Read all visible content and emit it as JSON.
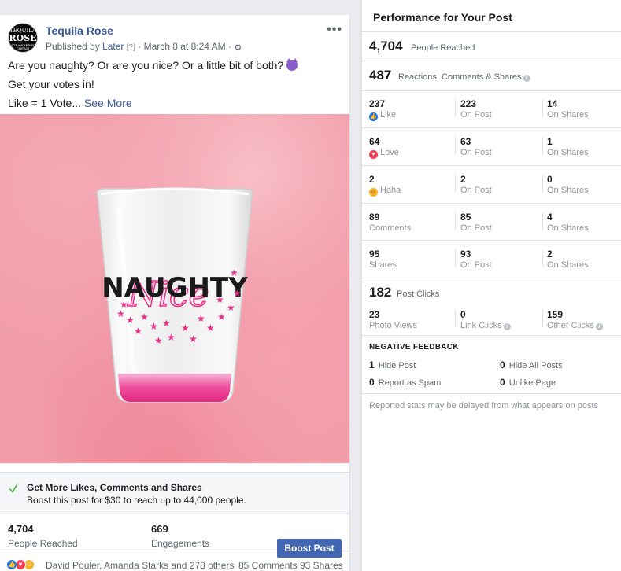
{
  "post": {
    "page_name": "Tequila Rose",
    "avatar_text": [
      "TEQUILA",
      "ROSE",
      "STRAWBERRY CREAM"
    ],
    "published_by_prefix": "Published by",
    "published_by": "Later",
    "help_mark": "[?]",
    "date": "March 8 at 8:24 AM",
    "more_label": "•••",
    "text_line1": "Are you naughty? Or are you nice? Or a little bit of both?",
    "text_line2": "Get your votes in!",
    "text_line3": "Like = 1 Vote...",
    "see_more": "See More",
    "image_text_main": "NAUGHTY",
    "image_text_script": "Nice",
    "boost_title": "Get More Likes, Comments and Shares",
    "boost_sub": "Boost this post for $30 to reach up to 44,000 people.",
    "people_reached_value": "4,704",
    "people_reached_label": "People Reached",
    "engagements_value": "669",
    "engagements_label": "Engagements",
    "boost_button": "Boost Post",
    "reaction_names": "David Pouler, Amanda Starks and 278 others",
    "comments_count": "85 Comments",
    "shares_count": "93 Shares"
  },
  "panel": {
    "title": "Performance for Your Post",
    "reached_value": "4,704",
    "reached_label": "People Reached",
    "rcs_value": "487",
    "rcs_label": "Reactions, Comments & Shares",
    "rows": [
      {
        "a": "237",
        "a_lbl": "Like",
        "b": "223",
        "b_lbl": "On Post",
        "c": "14",
        "c_lbl": "On Shares"
      },
      {
        "a": "64",
        "a_lbl": "Love",
        "b": "63",
        "b_lbl": "On Post",
        "c": "1",
        "c_lbl": "On Shares"
      },
      {
        "a": "2",
        "a_lbl": "Haha",
        "b": "2",
        "b_lbl": "On Post",
        "c": "0",
        "c_lbl": "On Shares"
      },
      {
        "a": "89",
        "a_lbl": "Comments",
        "b": "85",
        "b_lbl": "On Post",
        "c": "4",
        "c_lbl": "On Shares"
      },
      {
        "a": "95",
        "a_lbl": "Shares",
        "b": "93",
        "b_lbl": "On Post",
        "c": "2",
        "c_lbl": "On Shares"
      }
    ],
    "clicks_value": "182",
    "clicks_label": "Post Clicks",
    "photo_views": "23",
    "photo_views_label": "Photo Views",
    "link_clicks": "0",
    "link_clicks_label": "Link Clicks",
    "other_clicks": "159",
    "other_clicks_label": "Other Clicks",
    "negative_title": "NEGATIVE FEEDBACK",
    "hide_post_value": "1",
    "hide_post_label": "Hide Post",
    "hide_all_value": "0",
    "hide_all_label": "Hide All Posts",
    "spam_value": "0",
    "spam_label": "Report as Spam",
    "unlike_value": "0",
    "unlike_label": "Unlike Page",
    "footnote": "Reported stats may be delayed from what appears on posts"
  },
  "colors": {
    "link_blue": "#385898",
    "button_blue": "#4267b2",
    "like_blue": "#1877f2",
    "love_red": "#f33e58",
    "haha_yellow": "#f7b125",
    "image_pink": "#f19aa8",
    "shot_glass_pink": "#e8328a"
  },
  "icons": [
    "gear-icon",
    "more-options-icon",
    "devil-emoji-icon",
    "leaf-check-icon",
    "like-reaction-icon",
    "love-reaction-icon",
    "haha-reaction-icon",
    "info-icon"
  ]
}
